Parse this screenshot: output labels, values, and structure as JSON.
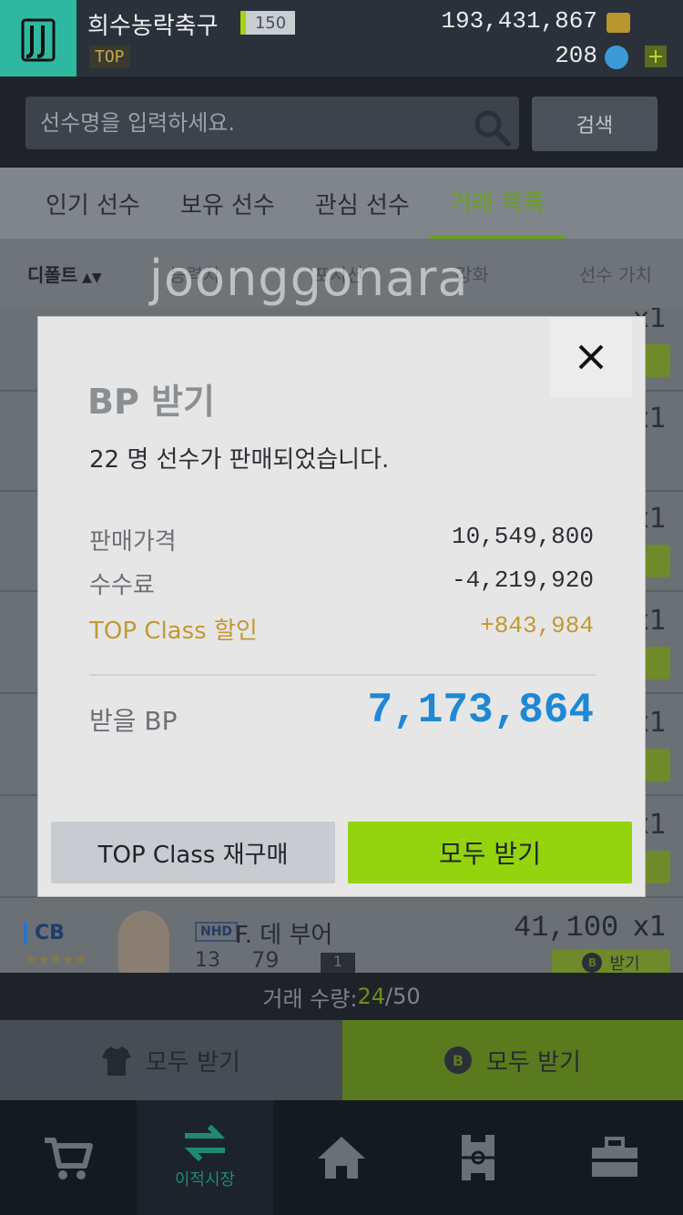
{
  "header": {
    "team_name": "희수농락축구",
    "level": "150",
    "tier_badge": "TOP",
    "coins": "193,431,867",
    "points": "208",
    "plus_label": "+"
  },
  "search": {
    "placeholder": "선수명을 입력하세요.",
    "button_label": "검색"
  },
  "tabs": [
    {
      "label": "인기 선수"
    },
    {
      "label": "보유 선수"
    },
    {
      "label": "관심 선수"
    },
    {
      "label": "거래 목록"
    }
  ],
  "active_tab": "거래 목록",
  "sort": {
    "default_label": "디폴트",
    "columns": [
      "능력치",
      "포지션",
      "강화",
      "선수 가치"
    ]
  },
  "list": {
    "visible_rows": [
      {
        "qty": "x1"
      },
      {
        "qty": "x1"
      },
      {
        "qty": "x1"
      },
      {
        "qty": "x1"
      },
      {
        "qty": "x1"
      },
      {
        "qty": "x1"
      }
    ],
    "cb_player": {
      "position": "CB",
      "team_tag": "NHD",
      "name": "F. 데 부어",
      "number": "13",
      "ovr": "79",
      "grade": "1",
      "price": "41,100",
      "qty": "x1",
      "receive_label": "받기"
    }
  },
  "trade_count": {
    "label": "거래 수량: ",
    "current": "24",
    "max": "/50"
  },
  "claim_buttons": {
    "left_label": "모두 받기",
    "right_label": "모두 받기",
    "right_icon_letter": "B"
  },
  "nav": {
    "items": [
      {
        "name": "cart-icon",
        "label": ""
      },
      {
        "name": "transfer-icon",
        "label": "이적시장"
      },
      {
        "name": "home-icon",
        "label": ""
      },
      {
        "name": "field-icon",
        "label": ""
      },
      {
        "name": "briefcase-icon",
        "label": ""
      }
    ]
  },
  "modal": {
    "title": "BP 받기",
    "message": "22 명 선수가 판매되었습니다.",
    "sale_price_label": "판매가격",
    "sale_price_value": "10,549,800",
    "fee_label": "수수료",
    "fee_value": "-4,219,920",
    "discount_label": "TOP Class 할인",
    "discount_value": "+843,984",
    "total_label": "받을 BP",
    "total_value": "7,173,864",
    "repurchase_label": "TOP Class 재구매",
    "claim_all_label": "모두 받기"
  },
  "watermark": "joonggonara",
  "colors": {
    "accent_green": "#93d40e",
    "total_blue": "#1e88d6",
    "gold": "#c29a32",
    "club_teal": "#2eb8a0"
  }
}
